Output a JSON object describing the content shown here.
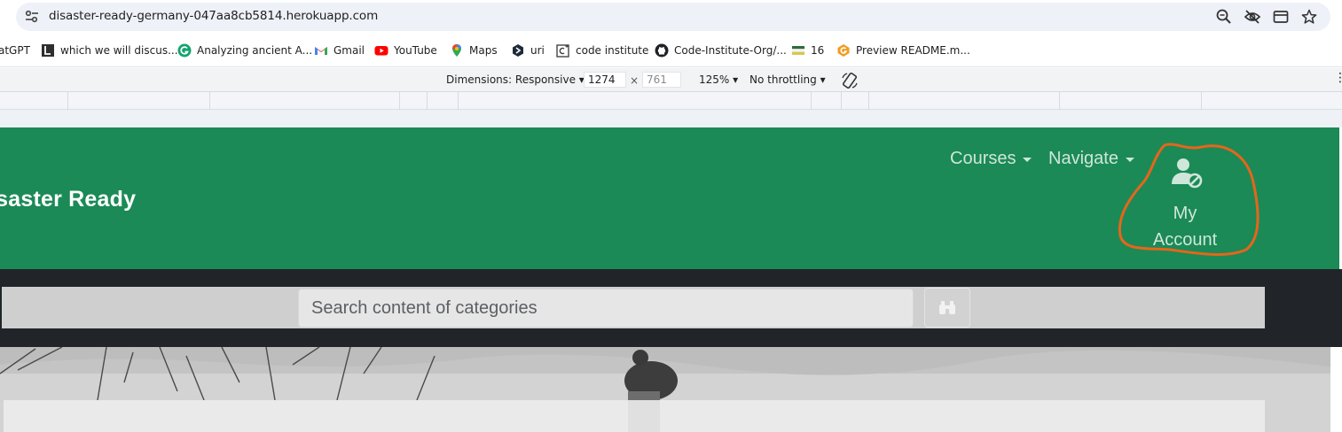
{
  "browser": {
    "url": "disaster-ready-germany-047aa8cb5814.herokuapp.com",
    "omnibox_icons": [
      "site-settings-icon",
      "zoom-icon",
      "eye-off-icon",
      "tab-panel-icon",
      "star-icon"
    ],
    "bookmarks": [
      {
        "label": "atGPT",
        "icon": "chatgpt-icon"
      },
      {
        "label": "which we will discus...",
        "icon": "bookmark-l-icon"
      },
      {
        "label": "Analyzing ancient A...",
        "icon": "grammarly-icon"
      },
      {
        "label": "Gmail",
        "icon": "gmail-icon"
      },
      {
        "label": "YouTube",
        "icon": "youtube-icon"
      },
      {
        "label": "Maps",
        "icon": "maps-icon"
      },
      {
        "label": "uri",
        "icon": "uri-icon"
      },
      {
        "label": "code institute",
        "icon": "code-institute-icon"
      },
      {
        "label": "Code-Institute-Org/...",
        "icon": "github-icon"
      },
      {
        "label": "16",
        "icon": "flag-icon"
      },
      {
        "label": "Preview README.m...",
        "icon": "preview-icon"
      }
    ]
  },
  "devtools": {
    "dimensions_label": "Dimensions: Responsive",
    "width": "1274",
    "x_sep": "×",
    "height": "761",
    "zoom": "125%",
    "throttling": "No throttling"
  },
  "site": {
    "brand": "isaster Ready",
    "nav": {
      "courses": "Courses",
      "navigate": "Navigate",
      "account_line1": "My",
      "account_line2": "Account"
    },
    "search": {
      "placeholder": "Search content of categories"
    },
    "colors": {
      "nav_green": "#1b8a56",
      "dark_strip": "#212529",
      "annotation": "#e5661b"
    }
  }
}
